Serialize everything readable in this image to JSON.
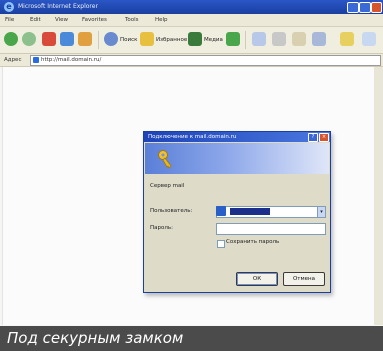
{
  "window": {
    "title": "Microsoft Internet Explorer",
    "accent_color": "#1a3fa0"
  },
  "menubar": {
    "items": [
      "File",
      "Edit",
      "View",
      "Favorites",
      "Tools",
      "Help"
    ]
  },
  "toolbar": {
    "back_icon": "back-arrow-icon",
    "forward_icon": "forward-arrow-icon",
    "search_label": "Поиск",
    "favorites_label": "Избранное",
    "media_label": "Медиа"
  },
  "address": {
    "label": "Адрес",
    "value": "http://mail.domain.ru/"
  },
  "dialog": {
    "title": "Подключение к mail.domain.ru",
    "help_glyph": "?",
    "close_glyph": "×",
    "prompt": "Сервер mail",
    "user_label": "Пользователь:",
    "password_label": "Пароль:",
    "remember_label": "Сохранить пароль",
    "ok_label": "ОК",
    "cancel_label": "Отмена",
    "dropdown_glyph": "▾",
    "key_icon": "key-icon"
  },
  "caption": {
    "text": "Под секурным замком"
  }
}
